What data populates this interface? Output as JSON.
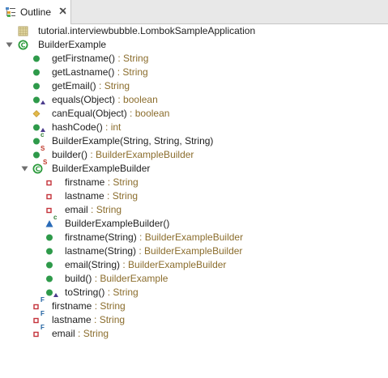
{
  "tab": {
    "title": "Outline",
    "icon": "outline-icon",
    "close_icon": "close-icon"
  },
  "colors": {
    "public_method": "#2e9a4a",
    "protected_method": "#e2b94a",
    "private_field": "#c4323a",
    "class": "#2b9a3b",
    "type_suffix": "#8b6d2d",
    "package": "#b3a36a",
    "constructor_triangle": "#2a6bb8"
  },
  "tree": [
    {
      "kind": "package",
      "name": "tutorial.interviewbubble.LombokSampleApplication",
      "type": "",
      "icon": "package-icon"
    },
    {
      "kind": "class",
      "name": "BuilderExample",
      "type": "",
      "icon": "class-icon",
      "expanded": true
    },
    {
      "kind": "method-public",
      "name": "getFirstname()",
      "type": " : String",
      "icon": "public-method-icon"
    },
    {
      "kind": "method-public",
      "name": "getLastname()",
      "type": " : String",
      "icon": "public-method-icon"
    },
    {
      "kind": "method-public",
      "name": "getEmail()",
      "type": " : String",
      "icon": "public-method-icon"
    },
    {
      "kind": "method-public-override",
      "name": "equals(Object)",
      "type": " : boolean",
      "icon": "override-method-icon"
    },
    {
      "kind": "method-protected",
      "name": "canEqual(Object)",
      "type": " : boolean",
      "icon": "protected-method-icon"
    },
    {
      "kind": "method-public-override",
      "name": "hashCode()",
      "type": " : int",
      "icon": "override-method-icon"
    },
    {
      "kind": "constructor",
      "name": "BuilderExample(String, String, String)",
      "type": "",
      "icon": "constructor-icon",
      "marker": "c"
    },
    {
      "kind": "method-static",
      "name": "builder()",
      "type": " : BuilderExampleBuilder",
      "icon": "static-method-icon",
      "marker": "S"
    },
    {
      "kind": "inner-class",
      "name": "BuilderExampleBuilder",
      "type": "",
      "icon": "static-class-icon",
      "marker": "S",
      "expanded": true
    },
    {
      "kind": "field-private",
      "name": "firstname",
      "type": " : String",
      "icon": "private-field-icon"
    },
    {
      "kind": "field-private",
      "name": "lastname",
      "type": " : String",
      "icon": "private-field-icon"
    },
    {
      "kind": "field-private",
      "name": "email",
      "type": " : String",
      "icon": "private-field-icon"
    },
    {
      "kind": "constructor-default",
      "name": "BuilderExampleBuilder()",
      "type": "",
      "icon": "default-constructor-icon",
      "marker": "c"
    },
    {
      "kind": "method-public",
      "name": "firstname(String)",
      "type": " : BuilderExampleBuilder",
      "icon": "public-method-icon"
    },
    {
      "kind": "method-public",
      "name": "lastname(String)",
      "type": " : BuilderExampleBuilder",
      "icon": "public-method-icon"
    },
    {
      "kind": "method-public",
      "name": "email(String)",
      "type": " : BuilderExampleBuilder",
      "icon": "public-method-icon"
    },
    {
      "kind": "method-public",
      "name": "build()",
      "type": " : BuilderExample",
      "icon": "public-method-icon"
    },
    {
      "kind": "method-public-override",
      "name": "toString()",
      "type": " : String",
      "icon": "override-method-icon"
    },
    {
      "kind": "field-final",
      "name": "firstname",
      "type": " : String",
      "icon": "final-field-icon",
      "marker": "F"
    },
    {
      "kind": "field-final",
      "name": "lastname",
      "type": " : String",
      "icon": "final-field-icon",
      "marker": "F"
    },
    {
      "kind": "field-final",
      "name": "email",
      "type": " : String",
      "icon": "final-field-icon",
      "marker": "F"
    }
  ]
}
